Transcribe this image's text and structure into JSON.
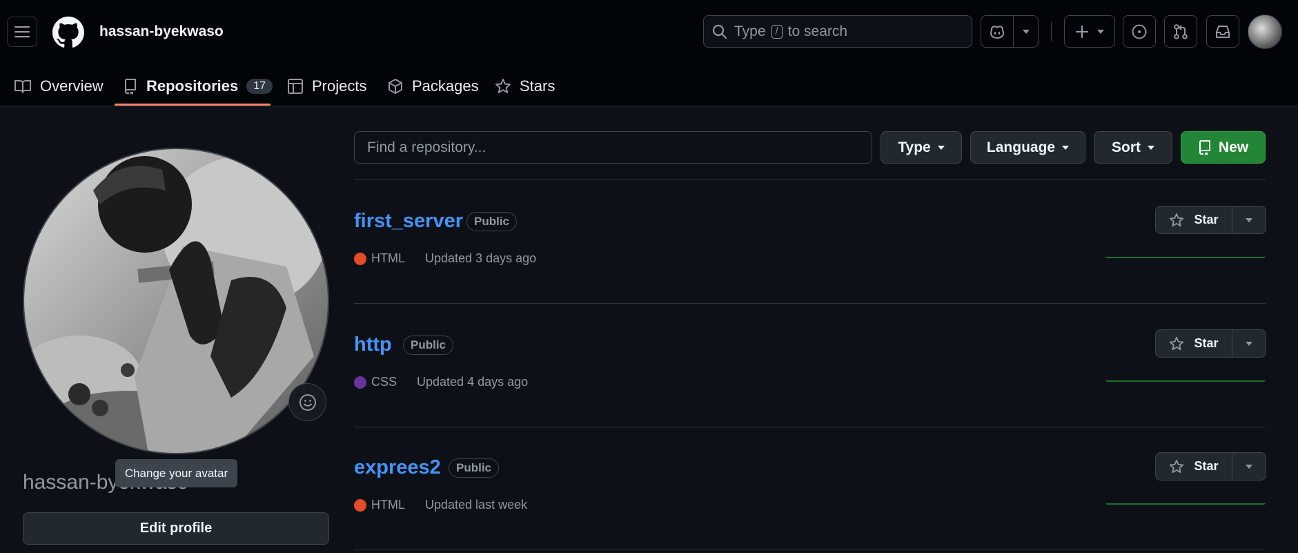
{
  "header": {
    "username": "hassan-byekwaso",
    "search_text_before": "Type",
    "search_key": "/",
    "search_text_after": "to search"
  },
  "tabs": [
    {
      "label": "Overview"
    },
    {
      "label": "Repositories",
      "count": "17"
    },
    {
      "label": "Projects"
    },
    {
      "label": "Packages"
    },
    {
      "label": "Stars"
    }
  ],
  "sidebar": {
    "display_name": "hassan-byekwaso",
    "tooltip": "Change your avatar",
    "edit_profile_label": "Edit profile"
  },
  "filters": {
    "find_placeholder": "Find a repository...",
    "type_label": "Type",
    "language_label": "Language",
    "sort_label": "Sort",
    "new_label": "New"
  },
  "repos": [
    {
      "name": "first_server",
      "visibility": "Public",
      "language": "HTML",
      "language_color": "#e34c26",
      "updated": "Updated 3 days ago",
      "star_label": "Star"
    },
    {
      "name": "http",
      "visibility": "Public",
      "language": "CSS",
      "language_color": "#663399",
      "updated": "Updated 4 days ago",
      "star_label": "Star"
    },
    {
      "name": "exprees2",
      "visibility": "Public",
      "language": "HTML",
      "language_color": "#e34c26",
      "updated": "Updated last week",
      "star_label": "Star"
    }
  ]
}
